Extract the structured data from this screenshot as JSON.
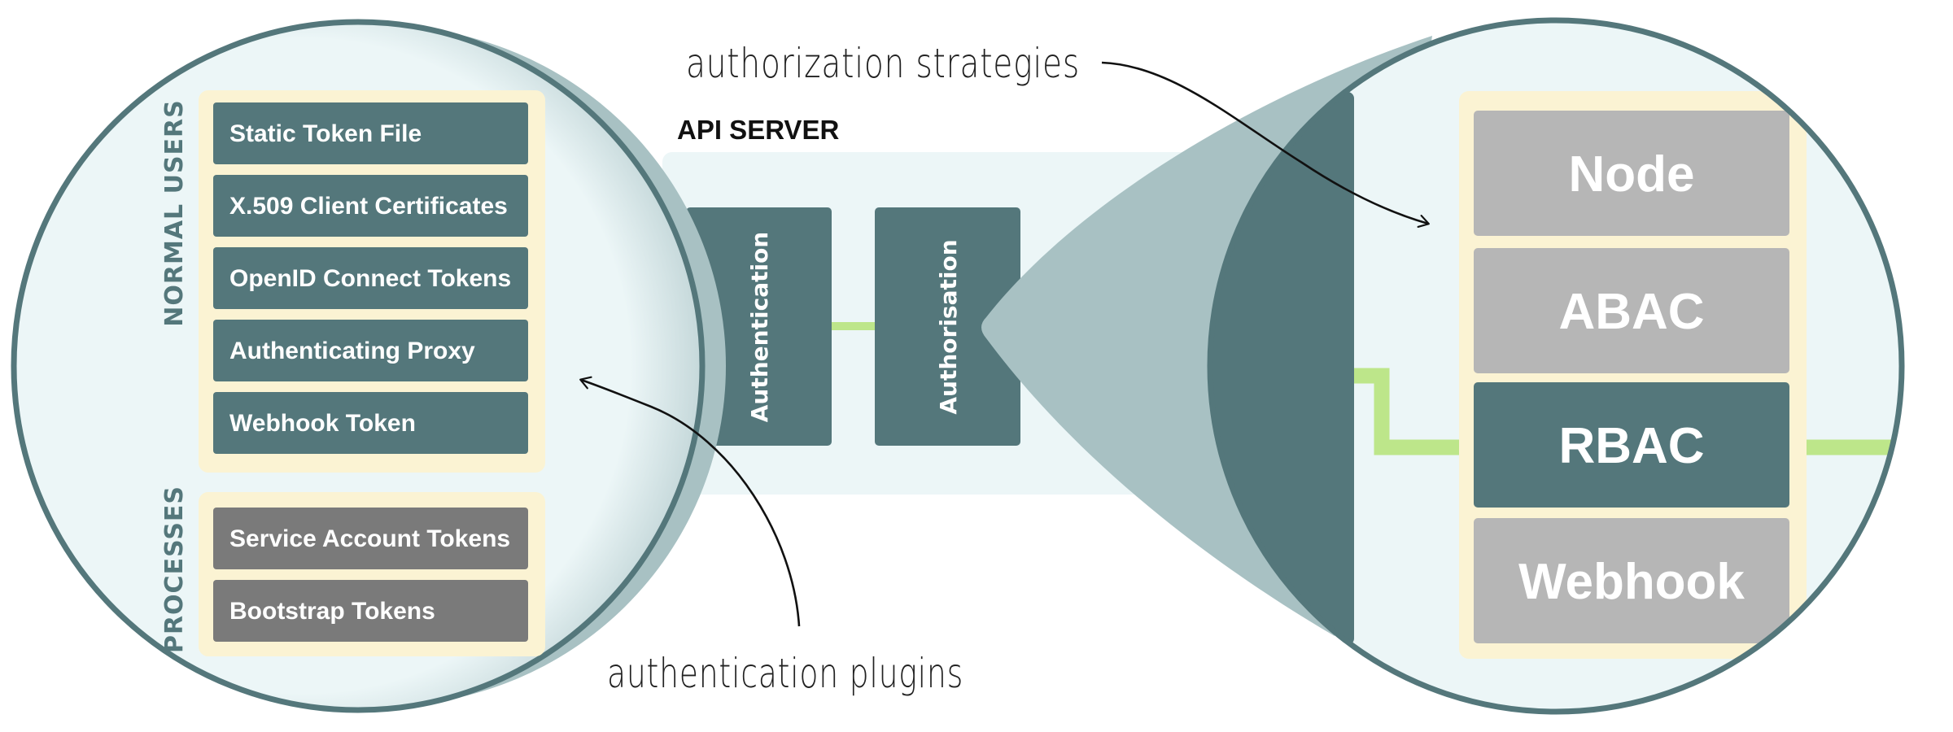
{
  "colors": {
    "teal_dark": "#54777b",
    "teal_light": "#a8c1c3",
    "circle_fill": "#ecf6f7",
    "group_fill": "#fbf3d3",
    "process_gray": "#7a7a7a",
    "strategy_gray": "#b6b6b6",
    "connector_green": "#bde68a",
    "text_white": "#ffffff",
    "title_black": "#111111"
  },
  "api_server": {
    "title": "API SERVER",
    "stages": [
      {
        "label": "Authentication"
      },
      {
        "label": "Authorisation"
      }
    ]
  },
  "authentication": {
    "groups": [
      {
        "label": "NORMAL USERS",
        "items": [
          {
            "label": "Static Token File",
            "style": "teal"
          },
          {
            "label": "X.509 Client Certificates",
            "style": "teal"
          },
          {
            "label": "OpenID Connect Tokens",
            "style": "teal"
          },
          {
            "label": "Authenticating Proxy",
            "style": "teal"
          },
          {
            "label": "Webhook Token",
            "style": "teal"
          }
        ]
      },
      {
        "label": "PROCESSES",
        "items": [
          {
            "label": "Service Account Tokens",
            "style": "gray"
          },
          {
            "label": "Bootstrap Tokens",
            "style": "gray"
          }
        ]
      }
    ]
  },
  "authorization": {
    "strategies": [
      {
        "label": "Node",
        "active": false
      },
      {
        "label": "ABAC",
        "active": false
      },
      {
        "label": "RBAC",
        "active": true
      },
      {
        "label": "Webhook",
        "active": false
      }
    ]
  },
  "annotations": {
    "authorization_strategies": "authorization strategies",
    "authentication_plugins": "authentication plugins"
  }
}
